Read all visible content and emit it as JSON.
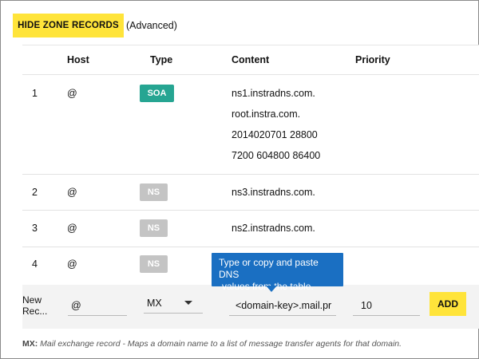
{
  "toolbar": {
    "hide_button_label": "HIDE ZONE RECORDS",
    "advanced_label": "(Advanced)"
  },
  "table": {
    "headers": {
      "host": "Host",
      "type": "Type",
      "content": "Content",
      "priority": "Priority"
    },
    "rows": [
      {
        "index": "1",
        "host": "@",
        "type": "SOA",
        "content": [
          "ns1.instradns.com.",
          "root.instra.com.",
          "2014020701 28800",
          "7200 604800 86400"
        ]
      },
      {
        "index": "2",
        "host": "@",
        "type": "NS",
        "content": [
          "ns3.instradns.com."
        ]
      },
      {
        "index": "3",
        "host": "@",
        "type": "NS",
        "content": [
          "ns2.instradns.com."
        ]
      },
      {
        "index": "4",
        "host": "@",
        "type": "NS",
        "content": []
      }
    ]
  },
  "tooltip": {
    "text_line1": "Type or copy and paste DNS",
    "text_line2": "values from the table."
  },
  "new_record": {
    "label_line1": "New",
    "label_line2": "Rec...",
    "host_value": "@",
    "type_value": "MX",
    "content_value": "<domain-key>.mail.pr",
    "priority_value": "10",
    "add_label": "ADD"
  },
  "footnote": {
    "term": "MX:",
    "description": "Mail exchange record - Maps a domain name to a list of message transfer agents for that domain."
  },
  "colors": {
    "accent_yellow": "#ffe43a",
    "soa_badge": "#26a592",
    "ns_badge": "#c4c4c4",
    "tooltip_blue": "#1a6fc2"
  }
}
